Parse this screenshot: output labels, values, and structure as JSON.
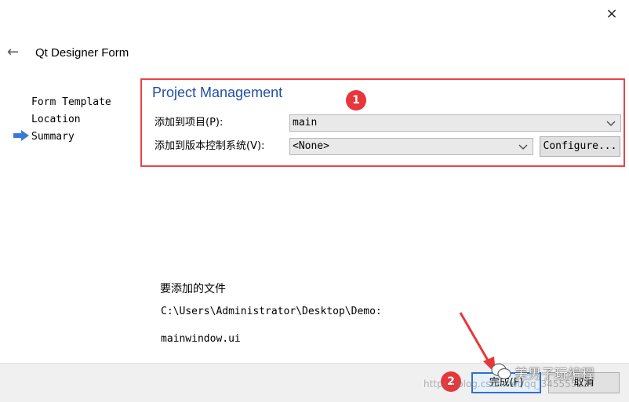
{
  "window": {
    "title": "Qt Designer Form",
    "close_glyph": "×",
    "back_glyph": "←"
  },
  "steps": [
    {
      "label": "Form Template"
    },
    {
      "label": "Location"
    },
    {
      "label": "Summary",
      "current": true
    }
  ],
  "section": {
    "title": "Project Management"
  },
  "fields": {
    "add_to_project_label": "添加到项目(P):",
    "add_to_project_value": "main",
    "add_to_vcs_label": "添加到版本控制系统(V):",
    "add_to_vcs_value": "<None>",
    "configure_label": "Configure..."
  },
  "files": {
    "heading": "要添加的文件",
    "path": "C:\\Users\\Administrator\\Desktop\\Demo:",
    "name": "mainwindow.ui"
  },
  "buttons": {
    "finish_label": "完成(F)",
    "cancel_label": "取消"
  },
  "annotations": {
    "badge_1": "1",
    "badge_2": "2",
    "highlight_color": "#e84444"
  },
  "watermark": {
    "text": "美男子玩编程",
    "url": "https://blog.csdn.net/qq_34555523"
  },
  "colors": {
    "accent": "#1f4fa6",
    "step_arrow": "#3a78d8",
    "badge": "#e8363b"
  }
}
